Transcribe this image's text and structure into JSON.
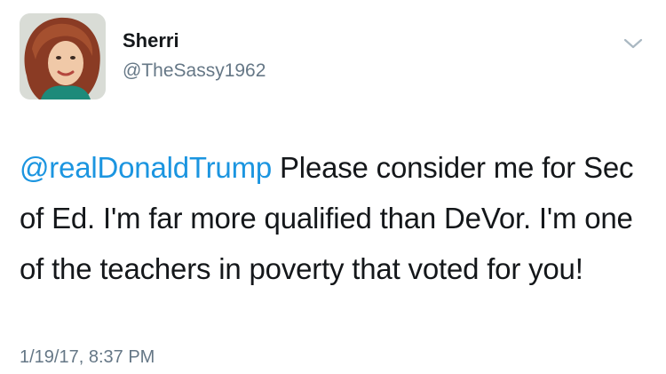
{
  "tweet": {
    "author": {
      "name": "Sherri",
      "handle": "@TheSassy1962"
    },
    "menu_icon": "chevron-down-icon",
    "mention": "@realDonaldTrump",
    "text": " Please consider me for Sec of Ed. I'm far more qualified than DeVor. I'm one of the teachers in poverty that voted for you!",
    "timestamp": "1/19/17, 8:37 PM"
  },
  "colors": {
    "link": "#1b95e0",
    "secondary_text": "#657786",
    "primary_text": "#14171a"
  }
}
